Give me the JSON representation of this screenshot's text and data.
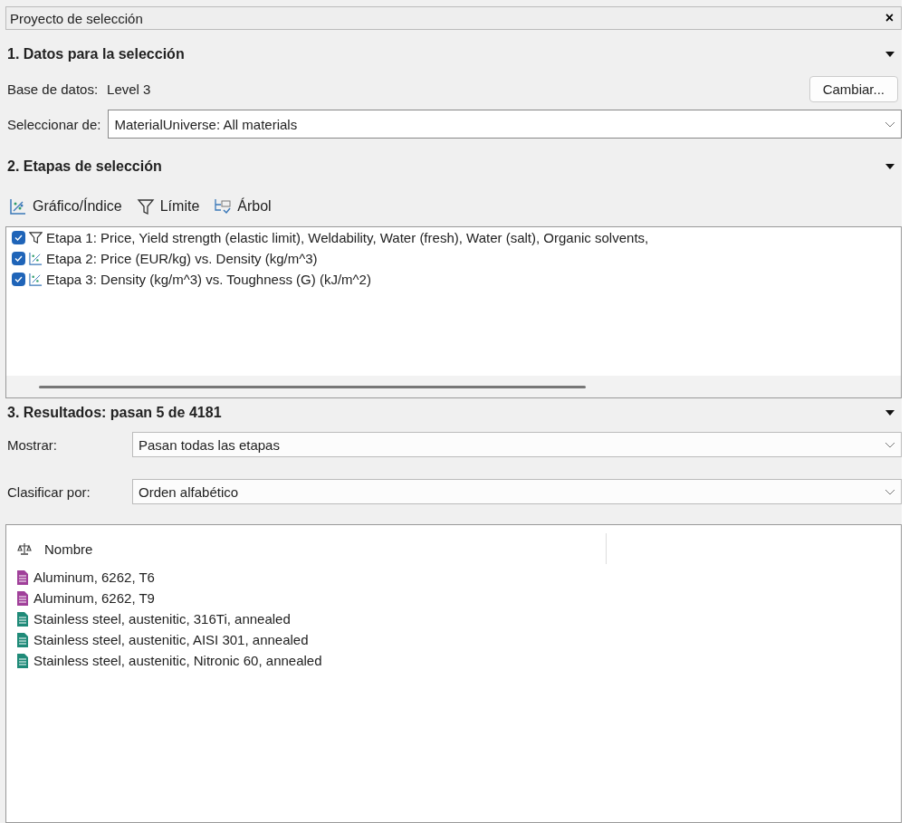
{
  "window": {
    "title": "Proyecto de selección",
    "close": "×"
  },
  "section1": {
    "title": "1. Datos para la selección",
    "expanded": true,
    "database_label": "Base de datos:",
    "database_value": "Level 3",
    "change_button": "Cambiar...",
    "select_label": "Seleccionar de:",
    "select_value": "MaterialUniverse: All materials"
  },
  "section2": {
    "title": "2. Etapas de selección",
    "expanded": true,
    "toolbar": [
      {
        "kind": "chart",
        "label": "Gráfico/Índice"
      },
      {
        "kind": "limit",
        "label": "Límite"
      },
      {
        "kind": "tree",
        "label": "Árbol"
      }
    ],
    "stages": [
      {
        "kind": "limit",
        "checked": true,
        "label": "Etapa 1: Price, Yield strength (elastic limit), Weldability, Water (fresh), Water (salt), Organic solvents,"
      },
      {
        "kind": "chart",
        "checked": true,
        "label": "Etapa 2: Price (EUR/kg) vs. Density (kg/m^3)"
      },
      {
        "kind": "chart",
        "checked": true,
        "label": "Etapa 3: Density (kg/m^3) vs. Toughness (G) (kJ/m^2)"
      }
    ]
  },
  "section3": {
    "title": "3. Resultados: pasan 5 de 4181",
    "expanded": true,
    "show_label": "Mostrar:",
    "show_value": "Pasan todas las etapas",
    "sort_label": "Clasificar por:",
    "sort_value": "Orden alfabético",
    "column": "Nombre",
    "results": [
      {
        "name": "Aluminum, 6262, T6",
        "color": "#a0409a"
      },
      {
        "name": "Aluminum, 6262, T9",
        "color": "#a0409a"
      },
      {
        "name": "Stainless steel, austenitic, 316Ti, annealed",
        "color": "#1f8a78"
      },
      {
        "name": "Stainless steel, austenitic, AISI 301, annealed",
        "color": "#1f8a78"
      },
      {
        "name": "Stainless steel, austenitic, Nitronic 60, annealed",
        "color": "#1f8a78"
      }
    ]
  }
}
